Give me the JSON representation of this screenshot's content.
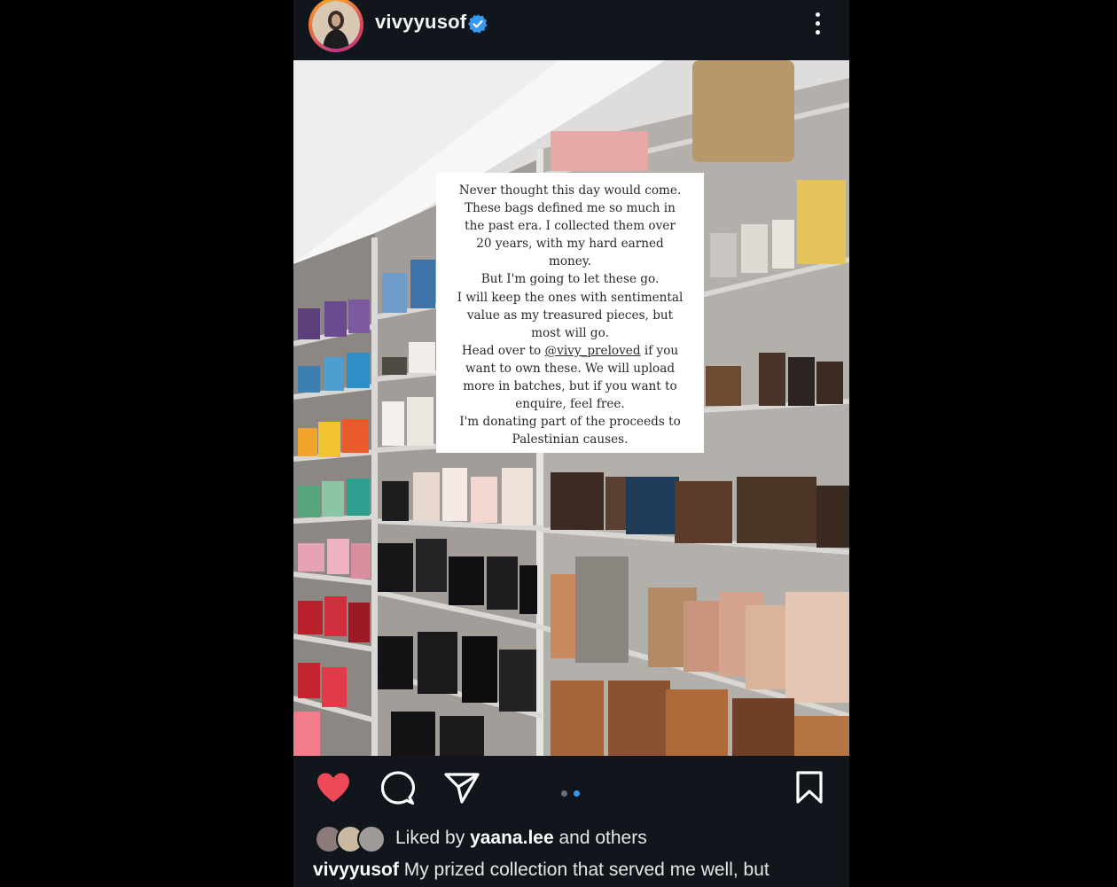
{
  "header": {
    "username": "vivyyusof",
    "verified_icon": "verified-badge-icon",
    "more_icon": "more-vertical-icon"
  },
  "post_image": {
    "overlay_text": {
      "line1": "Never thought this day would come.",
      "line2": "These bags defined me so much in",
      "line3": "the past era. I collected them over",
      "line4": "20 years, with my hard earned",
      "line5": "money.",
      "line6": "But I'm going to let these go.",
      "line7": "I will keep the ones with sentimental",
      "line8": "value as my treasured pieces, but",
      "line9": "most will go.",
      "line10_prefix": "Head over to ",
      "line10_mention": "@vivy_preloved",
      "line10_suffix": " if you",
      "line11": "want to own these. We will upload",
      "line12": "more in batches, but if you want to",
      "line13": "enquire, feel free.",
      "line14": "I'm donating part of the proceeds to",
      "line15": "Palestinian causes."
    }
  },
  "actions": {
    "like_icon": "heart-filled-icon",
    "comment_icon": "comment-icon",
    "share_icon": "send-icon",
    "save_icon": "bookmark-icon",
    "carousel_total": 2,
    "carousel_active": 2
  },
  "likes": {
    "prefix": "Liked by ",
    "user": "yaana.lee",
    "suffix": " and others"
  },
  "caption": {
    "username": "vivyyusof",
    "text": " My prized collection that served me well, but"
  },
  "colors": {
    "background": "#000000",
    "post_background": "#11151c",
    "like_red": "#ed4956",
    "verified_blue": "#3897f0",
    "dot_active": "#3897f0",
    "dot_inactive": "#6b6f76"
  }
}
